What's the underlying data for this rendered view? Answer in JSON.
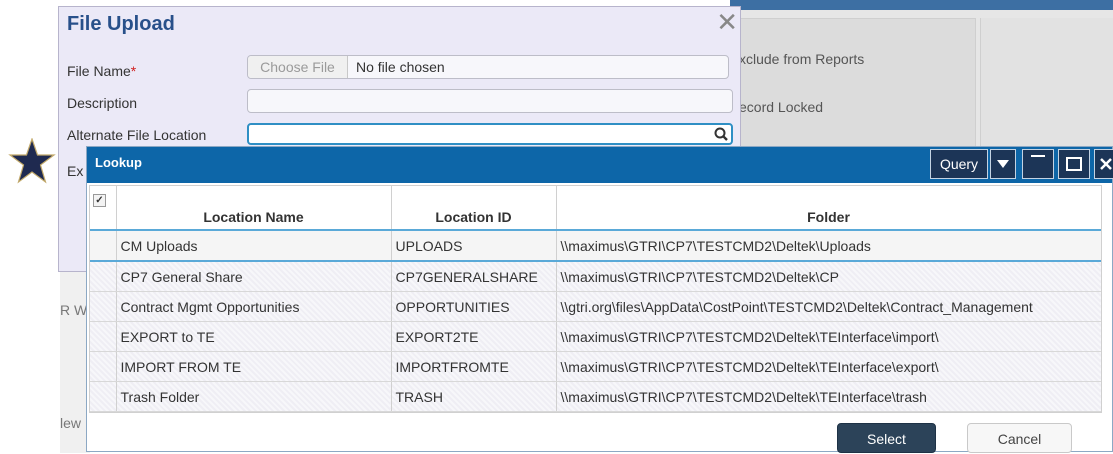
{
  "background": {
    "exclude_reports": "xclude from Reports",
    "record_locked": "ecord Locked",
    "left_fragment_1": "R W",
    "left_fragment_2": "lew"
  },
  "file_upload": {
    "title": "File Upload",
    "close_glyph": "✕",
    "file_name_label": "File Name",
    "required_mark": "*",
    "choose_file_label": "Choose File",
    "no_file_text": "No file chosen",
    "description_label": "Description",
    "description_value": "",
    "alt_location_label": "Alternate File Location",
    "alt_location_value": "",
    "partial_label": "Ex"
  },
  "lookup": {
    "title": "Lookup",
    "query_label": "Query",
    "columns": [
      "Location Name",
      "Location ID",
      "Folder"
    ],
    "rows": [
      {
        "name": "CM Uploads",
        "id": "UPLOADS",
        "folder": "\\\\maximus\\GTRI\\CP7\\TESTCMD2\\Deltek\\Uploads"
      },
      {
        "name": "CP7 General Share",
        "id": "CP7GENERALSHARE",
        "folder": "\\\\maximus\\GTRI\\CP7\\TESTCMD2\\Deltek\\CP"
      },
      {
        "name": "Contract Mgmt Opportunities",
        "id": "OPPORTUNITIES",
        "folder": "\\\\gtri.org\\files\\AppData\\CostPoint\\TESTCMD2\\Deltek\\Contract_Management"
      },
      {
        "name": "EXPORT to TE",
        "id": "EXPORT2TE",
        "folder": "\\\\maximus\\GTRI\\CP7\\TESTCMD2\\Deltek\\TEInterface\\import\\"
      },
      {
        "name": "IMPORT FROM TE",
        "id": "IMPORTFROMTE",
        "folder": "\\\\maximus\\GTRI\\CP7\\TESTCMD2\\Deltek\\TEInterface\\export\\"
      },
      {
        "name": "Trash Folder",
        "id": "TRASH",
        "folder": "\\\\maximus\\GTRI\\CP7\\TESTCMD2\\Deltek\\TEInterface\\trash"
      }
    ],
    "select_label": "Select",
    "cancel_label": "Cancel"
  },
  "colors": {
    "lookup_header": "#0d66a8",
    "title_blue": "#28508a",
    "select_button": "#2c4359",
    "star": "#1f2a50"
  },
  "icons": [
    "star-icon",
    "search-icon",
    "close-icon",
    "dropdown-arrow-icon",
    "minimize-icon",
    "maximize-icon",
    "checkbox-icon"
  ]
}
